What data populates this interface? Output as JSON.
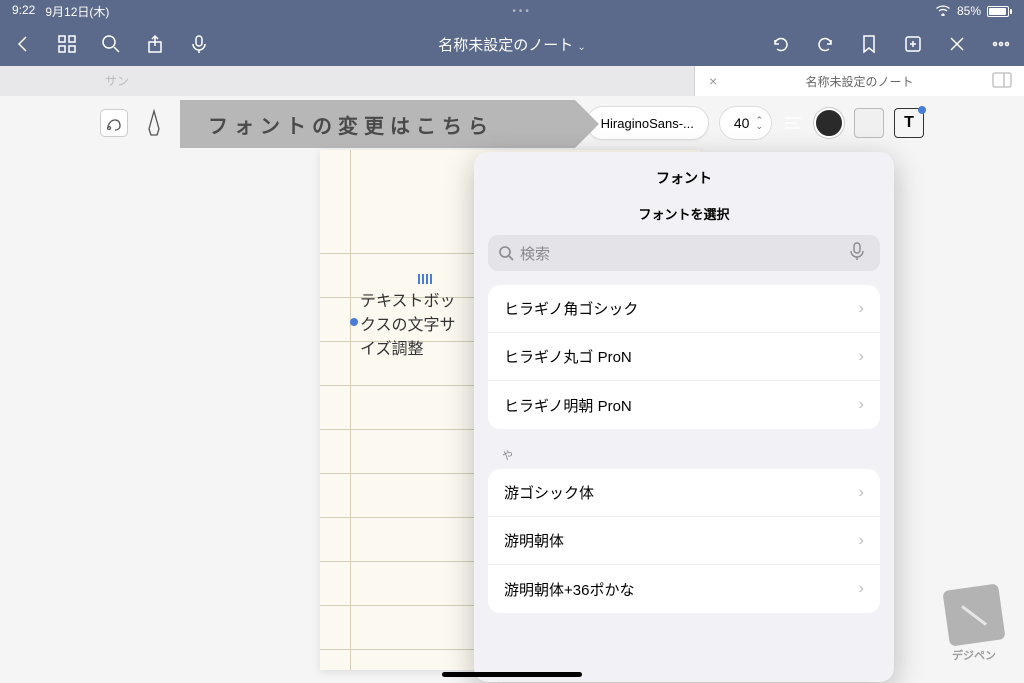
{
  "status": {
    "time": "9:22",
    "date": "9月12日(木)",
    "battery_pct": "85%"
  },
  "nav": {
    "title": "名称未設定のノート",
    "chevron": "⌄"
  },
  "tabs": {
    "phantom": "サン",
    "active": {
      "title": "名称未設定のノート",
      "close": "×"
    }
  },
  "toolbar": {
    "font_name": "HiraginoSans-...",
    "font_size": "40",
    "text_tool": "T"
  },
  "callout": "フォントの変更はこちら",
  "textbox": {
    "line1": "テキストボッ",
    "line2": "クスの文字サ",
    "line3": "イズ調整"
  },
  "popover": {
    "title": "フォント",
    "subtitle": "フォントを選択",
    "search_placeholder": "検索",
    "group1": [
      {
        "label": "ヒラギノ角ゴシック"
      },
      {
        "label": "ヒラギノ丸ゴ ProN"
      },
      {
        "label": "ヒラギノ明朝 ProN"
      }
    ],
    "group2_label": "や",
    "group2": [
      {
        "label": "游ゴシック体"
      },
      {
        "label": "游明朝体"
      },
      {
        "label": "游明朝体+36ポかな"
      }
    ]
  },
  "watermark": "デジペン"
}
